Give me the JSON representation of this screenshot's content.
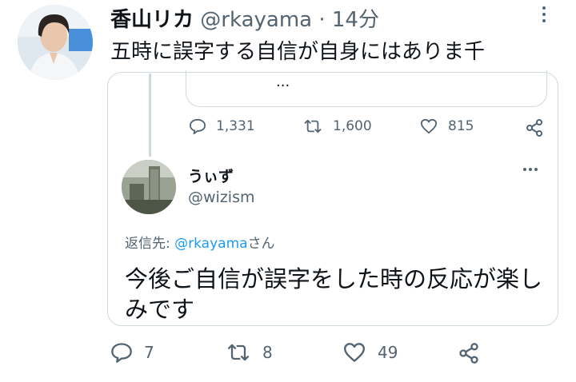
{
  "tweet": {
    "author_name": "香山リカ",
    "author_handle": "@rkayama",
    "separator": "·",
    "time": "14分",
    "text": "五時に誤字する自信が自身にはありま千",
    "avatar_icon": "profile-photo-icon",
    "more_icon": "more-vertical-icon"
  },
  "quoted": {
    "text": "...",
    "stats": {
      "replies": "1,331",
      "retweets": "1,600",
      "likes": "815"
    }
  },
  "reply": {
    "author_name": "うぃず",
    "author_handle": "@wizism",
    "replying_prefix": "返信先: ",
    "replying_mention": "@rkayama",
    "replying_suffix": "さん",
    "text": "今後ご自信が誤字をした時の反応が楽しみです",
    "avatar_icon": "profile-photo-icon",
    "more_icon": "more-horizontal-icon"
  },
  "actions": {
    "replies": "7",
    "retweets": "8",
    "likes": "49"
  },
  "colors": {
    "text": "#0f1419",
    "muted": "#536471",
    "link": "#1d9bf0",
    "border": "#cfd9de"
  }
}
